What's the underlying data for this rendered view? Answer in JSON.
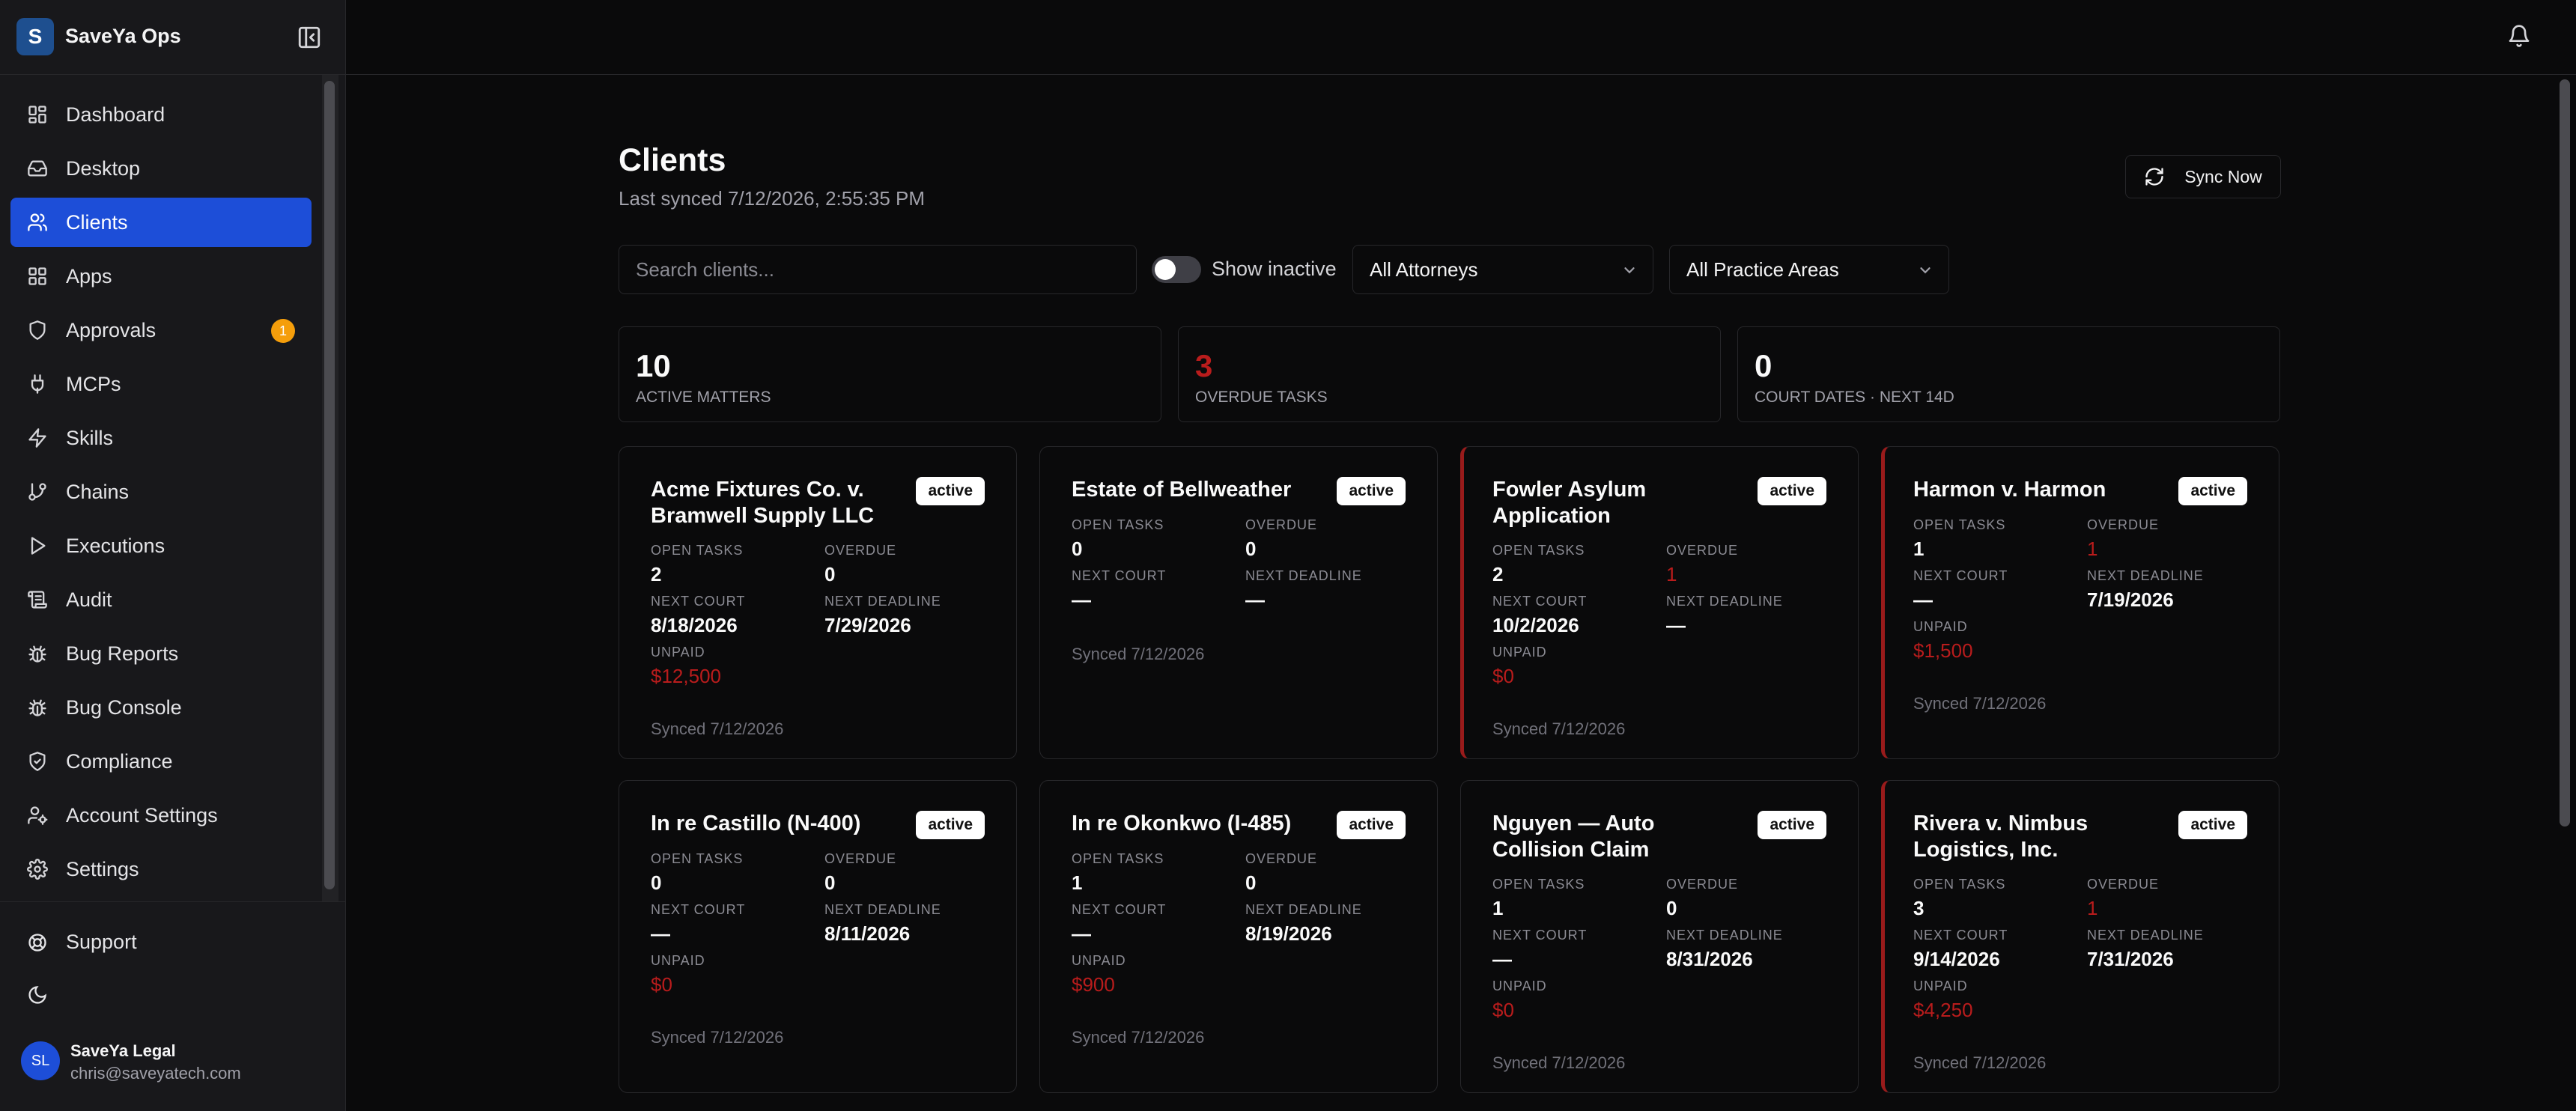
{
  "app": {
    "logo_letter": "S",
    "name": "SaveYa Ops"
  },
  "nav": [
    {
      "label": "Dashboard",
      "icon": "dashboard-icon"
    },
    {
      "label": "Desktop",
      "icon": "inbox-icon"
    },
    {
      "label": "Clients",
      "icon": "users-icon",
      "active": true
    },
    {
      "label": "Apps",
      "icon": "grid-icon"
    },
    {
      "label": "Approvals",
      "icon": "shield-icon",
      "badge": "1"
    },
    {
      "label": "MCPs",
      "icon": "plug-icon"
    },
    {
      "label": "Skills",
      "icon": "zap-icon"
    },
    {
      "label": "Chains",
      "icon": "git-branch-icon"
    },
    {
      "label": "Executions",
      "icon": "play-icon"
    },
    {
      "label": "Audit",
      "icon": "scroll-icon"
    },
    {
      "label": "Bug Reports",
      "icon": "bug-icon"
    },
    {
      "label": "Bug Console",
      "icon": "bug-icon"
    },
    {
      "label": "Compliance",
      "icon": "shield-check-icon"
    },
    {
      "label": "Account Settings",
      "icon": "user-cog-icon"
    },
    {
      "label": "Settings",
      "icon": "gear-icon"
    }
  ],
  "footer": {
    "support_label": "Support",
    "user": {
      "initials": "SL",
      "name": "SaveYa Legal",
      "email": "chris@saveyatech.com"
    }
  },
  "page": {
    "title": "Clients",
    "subtitle": "Last synced 7/12/2026, 2:55:35 PM",
    "sync_label": "Sync Now"
  },
  "filters": {
    "search_placeholder": "Search clients...",
    "show_inactive_label": "Show inactive",
    "attorney_select": "All Attorneys",
    "area_select": "All Practice Areas"
  },
  "stats": [
    {
      "value": "10",
      "label": "ACTIVE MATTERS"
    },
    {
      "value": "3",
      "label": "OVERDUE TASKS",
      "alert": true
    },
    {
      "value": "0",
      "label": "COURT DATES · NEXT 14D"
    }
  ],
  "labels": {
    "open_tasks": "OPEN TASKS",
    "overdue": "OVERDUE",
    "next_court": "NEXT COURT",
    "next_deadline": "NEXT DEADLINE",
    "unpaid": "UNPAID"
  },
  "cards": [
    {
      "title": "Acme Fixtures Co. v. Bramwell Supply LLC",
      "status": "active",
      "open_tasks": "2",
      "overdue": "0",
      "next_court": "8/18/2026",
      "next_deadline": "7/29/2026",
      "unpaid": "$12,500",
      "synced": "Synced 7/12/2026",
      "alert": false
    },
    {
      "title": "Estate of Bellweather",
      "status": "active",
      "open_tasks": "0",
      "overdue": "0",
      "next_court": "—",
      "next_deadline": "—",
      "unpaid": null,
      "synced": "Synced 7/12/2026",
      "alert": false
    },
    {
      "title": "Fowler Asylum Application",
      "status": "active",
      "open_tasks": "2",
      "overdue": "1",
      "next_court": "10/2/2026",
      "next_deadline": "—",
      "unpaid": "$0",
      "synced": "Synced 7/12/2026",
      "alert": true
    },
    {
      "title": "Harmon v. Harmon",
      "status": "active",
      "open_tasks": "1",
      "overdue": "1",
      "next_court": "—",
      "next_deadline": "7/19/2026",
      "unpaid": "$1,500",
      "synced": "Synced 7/12/2026",
      "alert": true
    },
    {
      "title": "In re Castillo (N-400)",
      "status": "active",
      "open_tasks": "0",
      "overdue": "0",
      "next_court": "—",
      "next_deadline": "8/11/2026",
      "unpaid": "$0",
      "synced": "Synced 7/12/2026",
      "alert": false
    },
    {
      "title": "In re Okonkwo (I-485)",
      "status": "active",
      "open_tasks": "1",
      "overdue": "0",
      "next_court": "—",
      "next_deadline": "8/19/2026",
      "unpaid": "$900",
      "synced": "Synced 7/12/2026",
      "alert": false
    },
    {
      "title": "Nguyen — Auto Collision Claim",
      "status": "active",
      "open_tasks": "1",
      "overdue": "0",
      "next_court": "—",
      "next_deadline": "8/31/2026",
      "unpaid": "$0",
      "synced": "Synced 7/12/2026",
      "alert": false
    },
    {
      "title": "Rivera v. Nimbus Logistics, Inc.",
      "status": "active",
      "open_tasks": "3",
      "overdue": "1",
      "next_court": "9/14/2026",
      "next_deadline": "7/31/2026",
      "unpaid": "$4,250",
      "synced": "Synced 7/12/2026",
      "alert": true
    }
  ],
  "colors": {
    "accent": "#1d4ed8",
    "alert": "#b91c1c",
    "badge": "#f59e0b"
  }
}
